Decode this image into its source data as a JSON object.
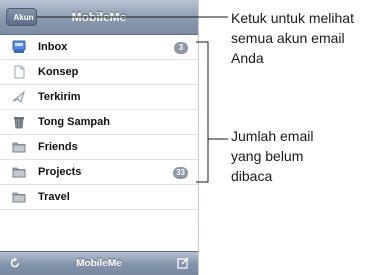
{
  "navbar": {
    "back_label": "Akun",
    "title": "MobileMe"
  },
  "mailboxes": [
    {
      "label": "Inbox",
      "icon": "inbox-icon",
      "badge": "3"
    },
    {
      "label": "Konsep",
      "icon": "drafts-icon",
      "badge": null
    },
    {
      "label": "Terkirim",
      "icon": "sent-icon",
      "badge": null
    },
    {
      "label": "Tong Sampah",
      "icon": "trash-icon",
      "badge": null
    },
    {
      "label": "Friends",
      "icon": "folder-icon",
      "badge": null
    },
    {
      "label": "Projects",
      "icon": "folder-icon",
      "badge": "33"
    },
    {
      "label": "Travel",
      "icon": "folder-icon",
      "badge": null
    }
  ],
  "toolbar": {
    "title": "MobileMe"
  },
  "callouts": {
    "accounts": "Ketuk untuk melihat semua akun email Anda",
    "unread": "Jumlah email yang belum dibaca"
  },
  "colors": {
    "navbar": "#8a9ab0",
    "badge": "#8c98a8",
    "icon_blue": "#4f7fd0"
  }
}
